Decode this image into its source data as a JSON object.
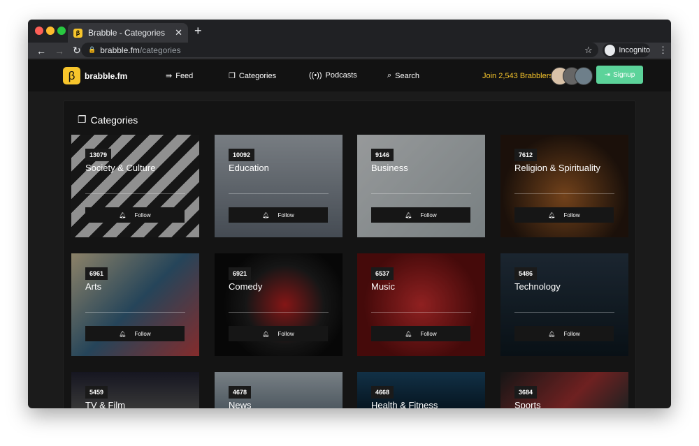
{
  "browser": {
    "tab_title": "Brabble - Categories",
    "url_host": "brabble.fm",
    "url_path": "/categories",
    "profile": "Incognito"
  },
  "site": {
    "brand": "brabble.fm",
    "logo_glyph": "β",
    "nav": [
      {
        "label": "Feed",
        "icon": "feed-icon"
      },
      {
        "label": "Categories",
        "icon": "categories-icon"
      },
      {
        "label": "Podcasts",
        "icon": "podcast-icon"
      },
      {
        "label": "Search",
        "icon": "search-icon"
      }
    ],
    "join_text": "Join 2,543 Brabblers",
    "signup_label": "Signup",
    "accent": "#f7c52b",
    "signup_color": "#5cd39a"
  },
  "page": {
    "title": "Categories",
    "follow_label": "Follow"
  },
  "categories": [
    {
      "name": "Society & Culture",
      "count": "13079"
    },
    {
      "name": "Education",
      "count": "10092"
    },
    {
      "name": "Business",
      "count": "9146"
    },
    {
      "name": "Religion & Spirituality",
      "count": "7612"
    },
    {
      "name": "Arts",
      "count": "6961"
    },
    {
      "name": "Comedy",
      "count": "6921"
    },
    {
      "name": "Music",
      "count": "6537"
    },
    {
      "name": "Technology",
      "count": "5486"
    },
    {
      "name": "TV & Film",
      "count": "5459"
    },
    {
      "name": "News",
      "count": "4678"
    },
    {
      "name": "Health & Fitness",
      "count": "4668"
    },
    {
      "name": "Sports",
      "count": "3684"
    }
  ]
}
